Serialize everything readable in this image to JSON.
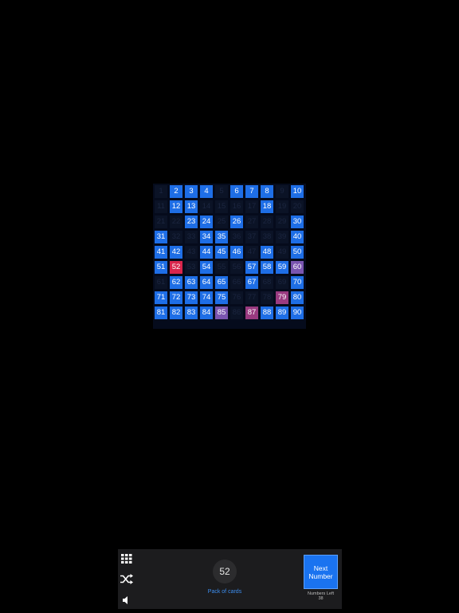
{
  "board": {
    "numbers": [
      1,
      2,
      3,
      4,
      5,
      6,
      7,
      8,
      9,
      10,
      11,
      12,
      13,
      14,
      15,
      16,
      17,
      18,
      19,
      20,
      21,
      22,
      23,
      24,
      25,
      26,
      27,
      28,
      29,
      30,
      31,
      32,
      33,
      34,
      35,
      36,
      37,
      38,
      39,
      40,
      41,
      42,
      43,
      44,
      45,
      46,
      47,
      48,
      49,
      50,
      51,
      52,
      53,
      54,
      55,
      56,
      57,
      58,
      59,
      60,
      61,
      62,
      63,
      64,
      65,
      66,
      67,
      68,
      69,
      70,
      71,
      72,
      73,
      74,
      75,
      76,
      77,
      78,
      79,
      80,
      81,
      82,
      83,
      84,
      85,
      86,
      87,
      88,
      89,
      90
    ],
    "called": [
      2,
      3,
      4,
      6,
      7,
      8,
      10,
      12,
      13,
      18,
      23,
      24,
      26,
      30,
      31,
      34,
      35,
      40,
      41,
      42,
      44,
      45,
      46,
      48,
      50,
      51,
      52,
      54,
      57,
      58,
      59,
      60,
      62,
      63,
      64,
      65,
      67,
      70,
      71,
      72,
      73,
      74,
      75,
      79,
      80,
      81,
      82,
      83,
      84,
      85,
      87,
      88,
      89,
      90
    ],
    "current": 52,
    "recent_purple": [
      60,
      85
    ],
    "recent_magenta": [
      79,
      87
    ]
  },
  "toolbar": {
    "icons": [
      "grid-icon",
      "shuffle-icon",
      "speaker-icon"
    ],
    "current_number": "52",
    "mode_label": "Pack of cards",
    "next_button_line1": "Next",
    "next_button_line2": "Number",
    "numbers_left_label": "Numbers Left",
    "numbers_left_count": "38"
  }
}
